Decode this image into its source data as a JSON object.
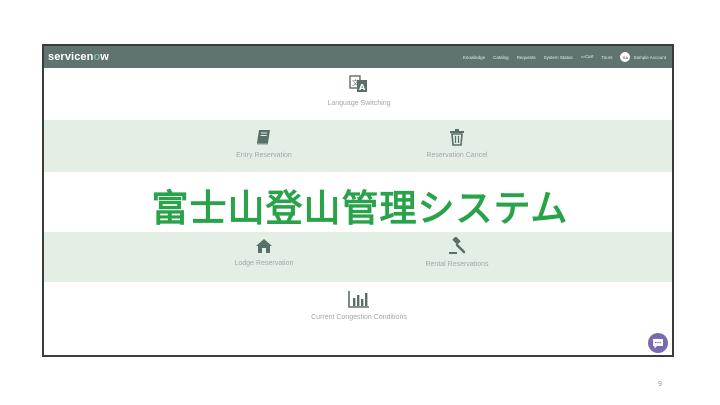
{
  "header": {
    "logo_main": "servicen",
    "logo_accent": "o",
    "logo_end": "w",
    "nav": [
      "Knowledge",
      "Catalog",
      "Requests",
      "System Status",
      "Cart",
      "Tours"
    ],
    "user_initials": "SA",
    "user_name": "Sample Account"
  },
  "tiles": {
    "language": "Language Switching",
    "entry": "Entry Reservation",
    "cancel": "Reservation Cancel",
    "lodge": "Lodge Reservation",
    "rental": "Rental Reservations",
    "congestion": "Current Congestion Conditions"
  },
  "overlay_title": "富士山登山管理システム",
  "page_number": "9",
  "colors": {
    "header_bg": "#5f7470",
    "band_bg": "#e3efe4",
    "icon": "#5b6f6a",
    "title": "#29a34a",
    "chat": "#7a6ab0"
  }
}
